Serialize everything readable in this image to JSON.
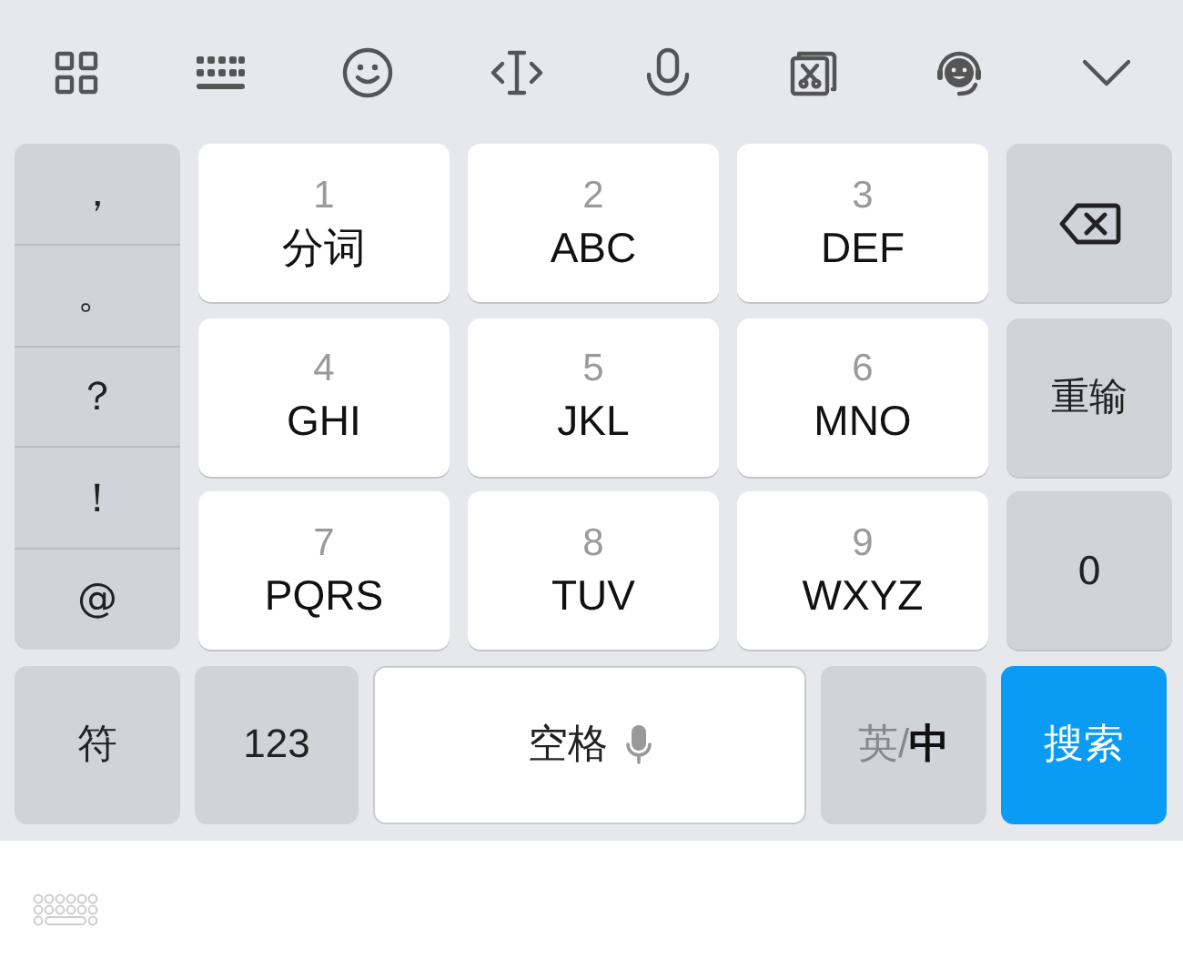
{
  "symbols": [
    "，",
    "。",
    "？",
    "！",
    "@"
  ],
  "keys": [
    {
      "digit": "1",
      "label": "分词"
    },
    {
      "digit": "2",
      "label": "ABC"
    },
    {
      "digit": "3",
      "label": "DEF"
    },
    {
      "digit": "4",
      "label": "GHI"
    },
    {
      "digit": "5",
      "label": "JKL"
    },
    {
      "digit": "6",
      "label": "MNO"
    },
    {
      "digit": "7",
      "label": "PQRS"
    },
    {
      "digit": "8",
      "label": "TUV"
    },
    {
      "digit": "9",
      "label": "WXYZ"
    }
  ],
  "side_keys": [
    {
      "kind": "backspace"
    },
    {
      "kind": "text",
      "label": "重输"
    },
    {
      "kind": "text",
      "label": "0"
    }
  ],
  "bottom_row": {
    "symbols_key": "符",
    "numbers_key": "123",
    "space_key": "空格",
    "language": {
      "separator": "/",
      "options": [
        {
          "label": "英",
          "selected": false
        },
        {
          "label": "中",
          "selected": true
        }
      ]
    },
    "action_key": "搜索"
  }
}
